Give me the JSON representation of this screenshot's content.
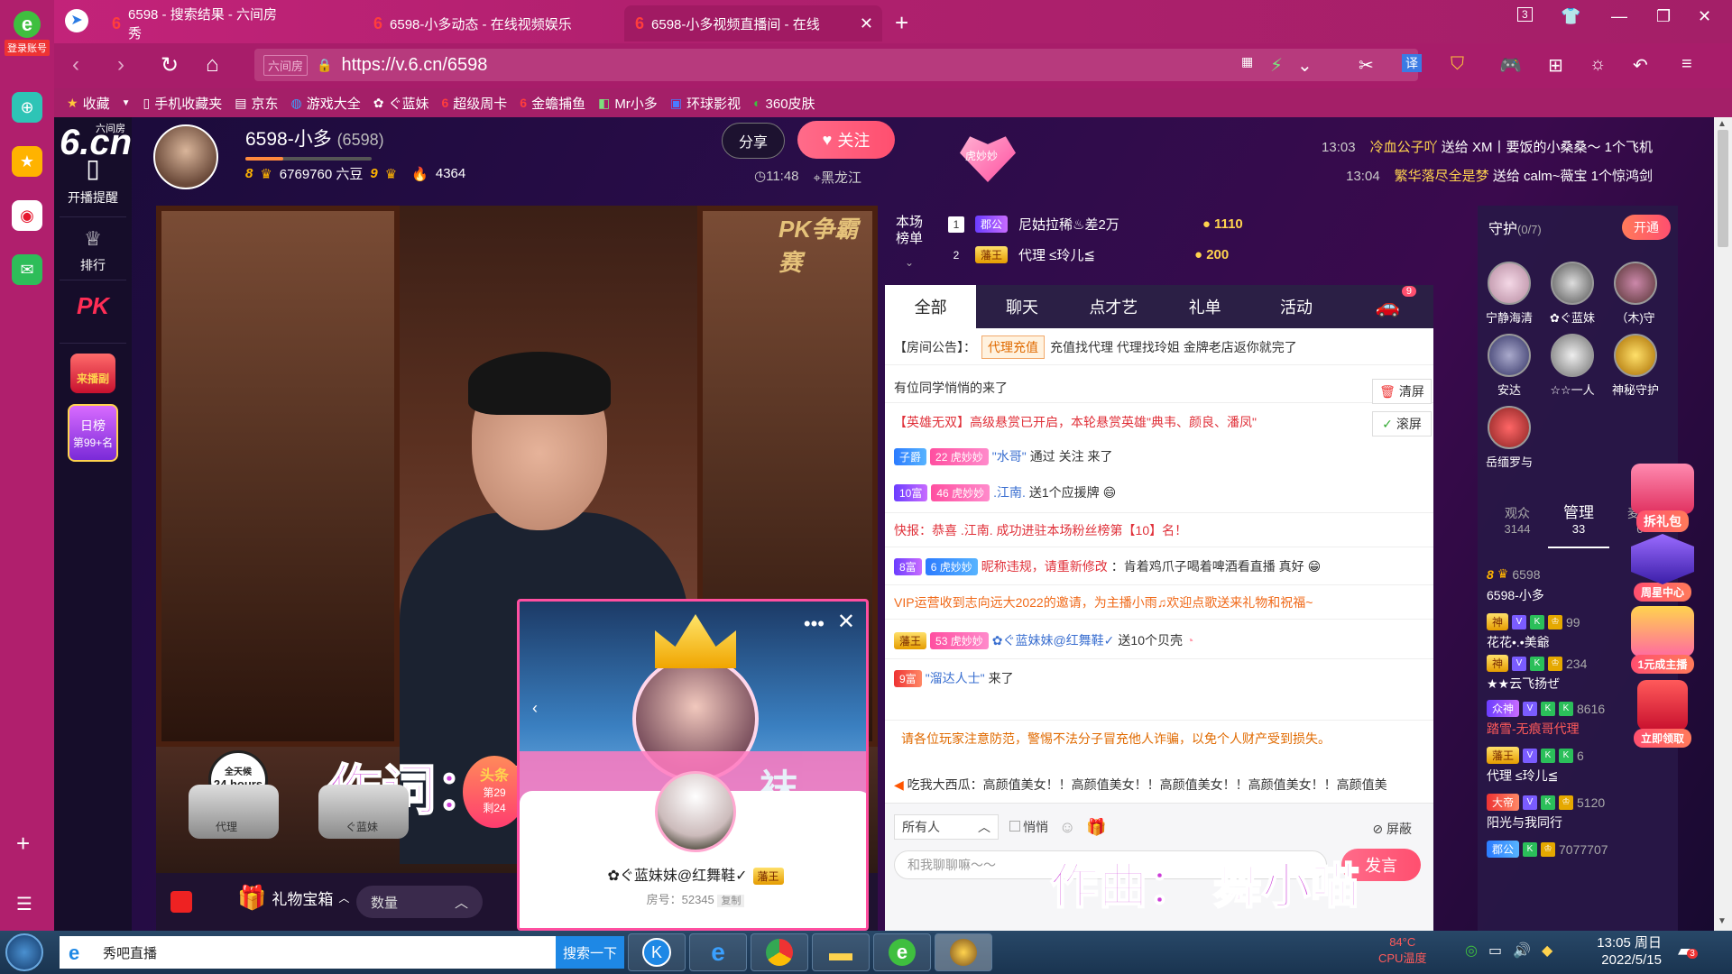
{
  "browser": {
    "tabs": [
      {
        "label": "6598 - 搜索结果 - 六间房秀"
      },
      {
        "label": "6598-小多动态 - 在线视频娱乐"
      },
      {
        "label": "6598-小多视频直播间 - 在线"
      }
    ],
    "url": "https://v.6.cn/6598",
    "site_tag": "六间房",
    "bookmarks": [
      "收藏",
      "手机收藏夹",
      "京东",
      "游戏大全",
      "ぐ蓝妹",
      "超级周卡",
      "金蟾捕鱼",
      "Mr小多",
      "环球影视",
      "360皮肤"
    ],
    "sidebar_login": "登录账号",
    "tab_count": "3"
  },
  "site": {
    "logo": "6.cn",
    "logo_small": "六间房",
    "nav": [
      {
        "label": "开播提醒",
        "icon": "phone-icon"
      },
      {
        "label": "排行",
        "icon": "crown-icon"
      },
      {
        "label": "PK",
        "icon": "pk-icon"
      },
      {
        "label": "来播副",
        "icon": "broadcast-icon"
      },
      {
        "label": "日榜",
        "icon": "daily-rank-icon"
      }
    ],
    "daily_rank_label": "第99+名"
  },
  "anchor": {
    "name": "6598-小多",
    "room_id": "(6598)",
    "level_left": "8",
    "beans": "6769760 六豆",
    "level_right": "9",
    "fans": "4364",
    "share_label": "分享",
    "follow_label": "关注",
    "time": "11:48",
    "location": "黑龙江"
  },
  "heart_badge": "虎妙妙",
  "broadcasts": [
    {
      "time": "13:03",
      "sender": "冷血公子吖",
      "verb": "送给",
      "receiver": "XM丨要饭的小桑桑～",
      "gift": "1个飞机"
    },
    {
      "time": "13:04",
      "sender": "繁华落尽全是梦",
      "verb": "送给",
      "receiver": "calm~薇宝",
      "gift": "1个惊鸿剑"
    }
  ],
  "video": {
    "pk_tag": "PK争霸赛",
    "lyric_top": "作词：舞小喵",
    "lyric_bottom": "作曲： 舞小喵",
    "seats": [
      {
        "label": "代理"
      },
      {
        "label": "ぐ蓝妹"
      }
    ],
    "seat_badge": "24 hours",
    "seat_badge_top": "全天候",
    "headline": "头条",
    "headline_rank": "第29",
    "headline_left": "剩24"
  },
  "gift_toolbar": {
    "gift_box": "礼物宝箱",
    "quantity": "数量"
  },
  "popup": {
    "name": "✿ぐ蓝妹妹@红舞鞋✓",
    "tag": "藩王",
    "room": "房号：52345",
    "copy": "复制",
    "banner_text": "袜"
  },
  "rank": {
    "title": "本场榜单",
    "rows": [
      {
        "n": "1",
        "tag": "郡公",
        "name": "尼姑拉稀♨差2万",
        "coins": "1110"
      },
      {
        "n": "2",
        "tag": "藩王",
        "name": "代理 ≤玲儿≦",
        "coins": "200"
      }
    ]
  },
  "chat": {
    "tabs": [
      "全部",
      "聊天",
      "点才艺",
      "礼单",
      "活动"
    ],
    "car_badge": "9",
    "notice_label": "【房间公告】：",
    "notice_hl": "代理充值",
    "notice_text": "充值找代理 代理找玲姐 金牌老店返你就完了",
    "lines": [
      {
        "text": "有位同学悄悄的来了"
      },
      {
        "text": "【英雄无双】高级悬赏已开启，本轮悬赏英雄\"典韦、颜良、潘凤\""
      },
      {
        "tag": "子爵",
        "tag2": "22",
        "tag2b": "虎妙妙",
        "user": "\"水哥\"",
        "text": "通过 关注 来了"
      },
      {
        "tag": "10富",
        "tag2": "46",
        "tag2b": "虎妙妙",
        "user": ".江南.",
        "text": "送1个应援牌"
      },
      {
        "text": "快报：恭喜 .江南. 成功进驻本场粉丝榜第【10】名！"
      },
      {
        "tag": "8富",
        "tag2": "6",
        "tag2b": "虎妙妙",
        "user": "昵称违规，请重新修改",
        "text": "：肯着鸡爪子喝着啤酒看直播 真好"
      },
      {
        "text": "VIP运营收到志向远大2022的邀请，为主播小雨♫欢迎点歌送来礼物和祝福~"
      },
      {
        "tag": "藩王",
        "tag2": "53",
        "tag2b": "虎妙妙",
        "user": "✿ぐ蓝妹妹@红舞鞋✓",
        "text": "送10个贝壳"
      },
      {
        "tag": "9富",
        "user": "\"溜达人士\"",
        "text": "来了"
      }
    ],
    "clear_btn": "清屏",
    "scroll_btn": "滚屏",
    "warning": "请各位玩家注意防范，警惕不法分子冒充他人诈骗，以免个人财产受到损失。",
    "ticker": "吃我大西瓜：高颜值美女！！高颜值美女！！高颜值美女！！高颜值美女！！高颜值美",
    "target_select": "所有人",
    "whisper": "悄悄",
    "shield": "屏蔽",
    "input_placeholder": "和我聊聊嘛～～",
    "send": "发言"
  },
  "guard": {
    "title": "守护",
    "count": "(0/7)",
    "open": "开通",
    "members": [
      "宁静海清",
      "✿ぐ蓝妹",
      "（木)守",
      "安达",
      "☆☆一人",
      "神秘守护",
      "岳缅罗与"
    ],
    "aud_tabs": [
      {
        "label": "观众",
        "count": "3144"
      },
      {
        "label": "管理",
        "count": "33"
      },
      {
        "label": "麦序",
        "count": "0"
      }
    ],
    "audience": [
      {
        "name": "6598",
        "sub": "6598-小多",
        "level": "8"
      },
      {
        "name": "花花•.•美爺",
        "tag": "神",
        "score": "99"
      },
      {
        "name": "★★云飞扬ぜ",
        "tag": "神",
        "score": "234"
      },
      {
        "name": "踏雪-无痕哥代理",
        "tag": "众神",
        "score": "8616"
      },
      {
        "name": "代理 ≤玲儿≦",
        "tag": "藩王",
        "score": "6"
      },
      {
        "name": "阳光与我同行",
        "tag": "大帝",
        "score": "5120"
      },
      {
        "name": "",
        "tag": "郡公",
        "score": "7077707"
      }
    ],
    "floaters": [
      "拆礼包",
      "周星中心",
      "1元成主播",
      "立即领取"
    ]
  },
  "taskbar": {
    "search_value": "秀吧直播",
    "search_btn": "搜索一下",
    "temp": "84°C",
    "temp_label": "CPU温度",
    "time": "13:05 周日",
    "date": "2022/5/15",
    "notif_count": "3"
  }
}
